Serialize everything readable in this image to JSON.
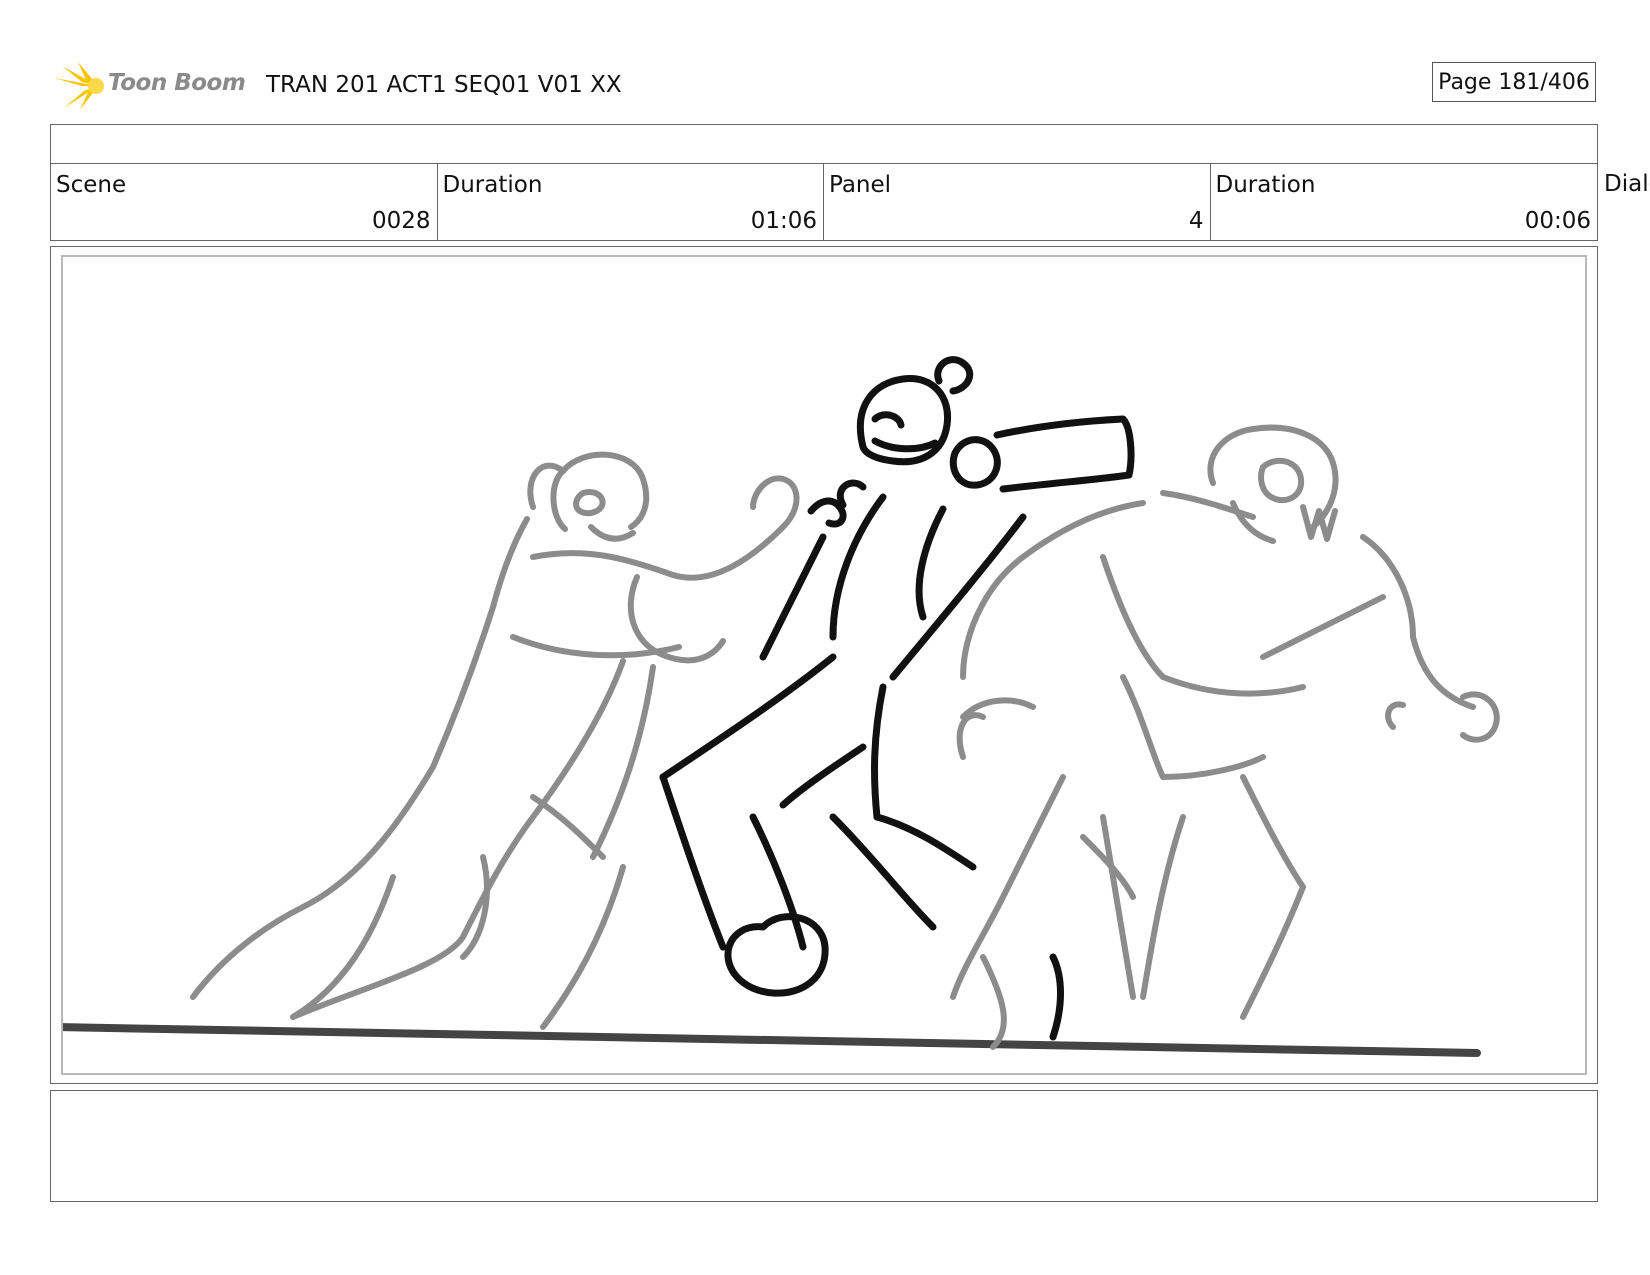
{
  "header": {
    "logo_text": "Toon Boom",
    "logo_icon": "starburst-logo-icon",
    "title": "TRAN 201 ACT1 SEQ01 V01 XX",
    "page_label": "Page 181/406"
  },
  "info": {
    "scene_label": "Scene",
    "scene_value": "0028",
    "scene_duration_label": "Duration",
    "scene_duration_value": "01:06",
    "panel_label": "Panel",
    "panel_value": "4",
    "panel_duration_label": "Duration",
    "panel_duration_value": "00:06",
    "overflow_label": "Dialo"
  },
  "colors": {
    "accent_logo": "#f7c600",
    "sketch_dark": "#111111",
    "sketch_light": "#8c8c8c",
    "ground_line": "#444444"
  }
}
